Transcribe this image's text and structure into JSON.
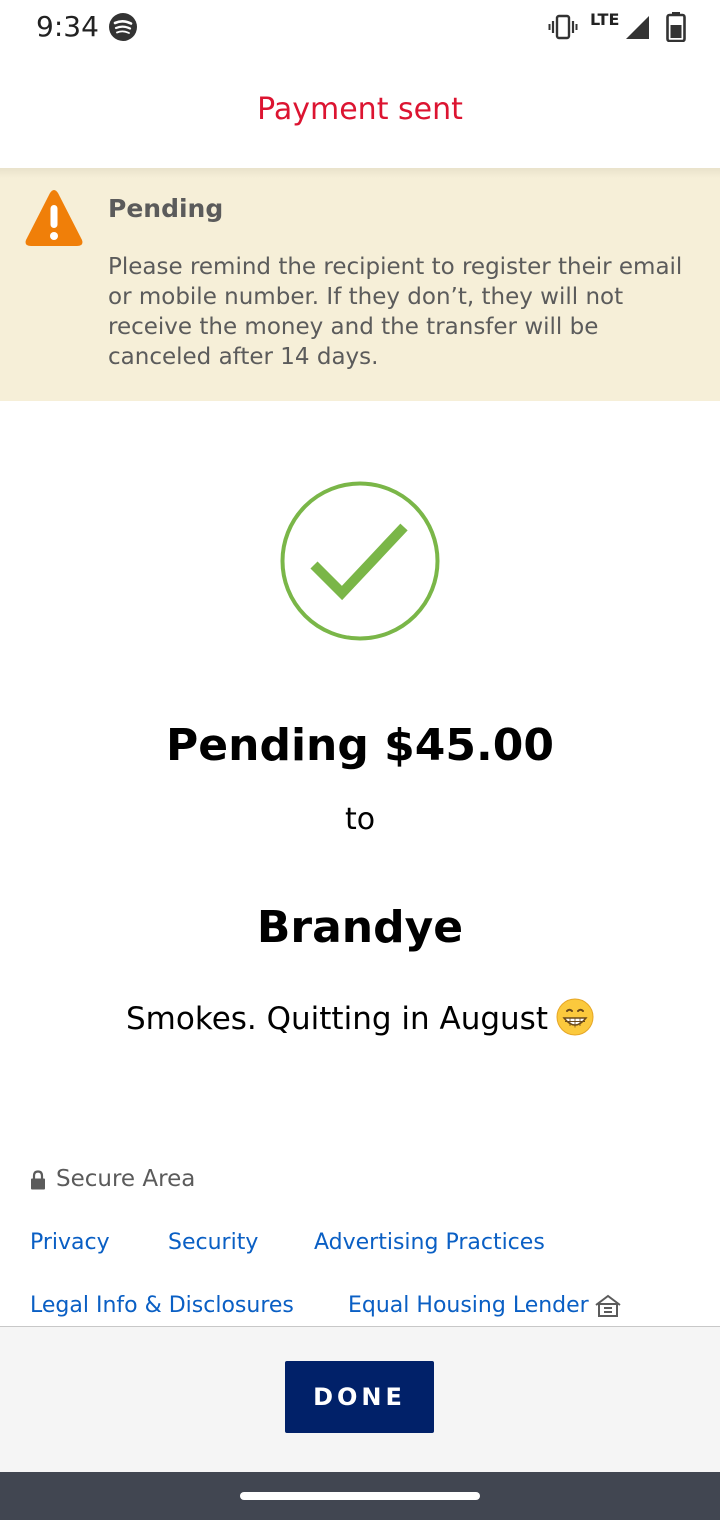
{
  "status_bar": {
    "time": "9:34",
    "network": "LTE",
    "icons": [
      "spotify-icon",
      "vibrate-icon",
      "signal-icon",
      "battery-icon"
    ]
  },
  "header": {
    "title": "Payment sent",
    "title_color": "#dc1431"
  },
  "banner": {
    "title": "Pending",
    "message": "Please remind the recipient to register their email or mobile number. If they don’t, they will not receive the money and the transfer will be canceled after 14 days.",
    "background": "#f6efd8",
    "icon": "warning-icon",
    "icon_color": "#f07f09"
  },
  "confirmation": {
    "icon": "checkmark-circle-icon",
    "icon_color": "#7ab648",
    "amount_line": "Pending $45.00",
    "to_label": "to",
    "recipient": "Brandye",
    "memo": "Smokes. Quitting in August",
    "memo_emoji": "grinning-face-icon"
  },
  "footer": {
    "secure_label": "Secure Area",
    "links": {
      "privacy": "Privacy",
      "security": "Security",
      "advertising": "Advertising Practices",
      "legal": "Legal Info & Disclosures",
      "equal_housing": "Equal Housing Lender"
    },
    "link_color": "#0a5fc4"
  },
  "actions": {
    "done_label": "DONE",
    "done_color": "#012169"
  }
}
